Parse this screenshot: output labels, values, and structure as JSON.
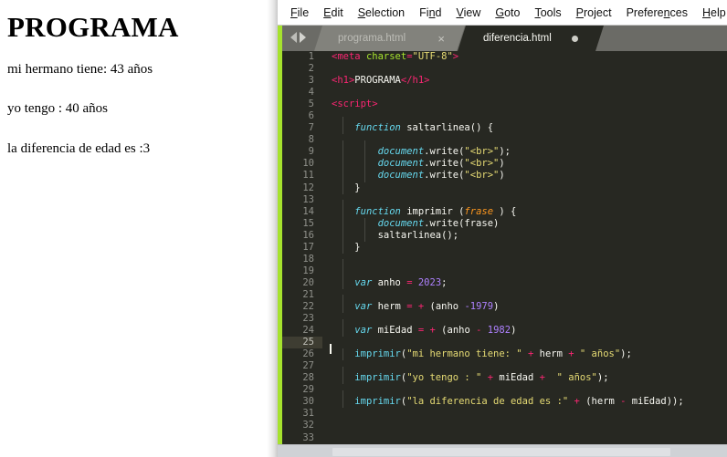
{
  "browser_output": {
    "heading": "PROGRAMA",
    "lines": [
      "mi hermano tiene: 43 años",
      "yo tengo : 40 años",
      "la diferencia de edad es :3"
    ]
  },
  "editor": {
    "app": "Sublime Text",
    "menu": [
      {
        "label": "File",
        "accel": "F"
      },
      {
        "label": "Edit",
        "accel": "E"
      },
      {
        "label": "Selection",
        "accel": "S"
      },
      {
        "label": "Find",
        "accel": "n"
      },
      {
        "label": "View",
        "accel": "V"
      },
      {
        "label": "Goto",
        "accel": "G"
      },
      {
        "label": "Tools",
        "accel": "T"
      },
      {
        "label": "Project",
        "accel": "P"
      },
      {
        "label": "Preferences",
        "accel": "n"
      },
      {
        "label": "Help",
        "accel": "H"
      }
    ],
    "tabs": [
      {
        "label": "programa.html",
        "active": false,
        "close_glyph": "×",
        "modified": false
      },
      {
        "label": "diferencia.html",
        "active": true,
        "close_glyph": "",
        "modified": true
      }
    ],
    "nav": {
      "back": "back-arrow",
      "forward": "forward-arrow"
    },
    "active_line": 25,
    "cursor_line": 25,
    "total_visible_lines": 33,
    "colors": {
      "background": "#272822",
      "gutter_text": "#8f908a",
      "active_line_bg": "#3e3d32",
      "accent_strip": "#a6e22e",
      "tag": "#f92672",
      "string": "#e6db74",
      "keyword": "#66d9ef",
      "number": "#ae81ff",
      "parameter": "#fd971f",
      "function": "#a6e22e",
      "plain": "#f8f8f2",
      "tabbar": "#6b6b66",
      "tab_inactive": "#82827c"
    },
    "code_lines": [
      {
        "n": 1,
        "text": "<meta charset=\"UTF-8\">"
      },
      {
        "n": 2,
        "text": ""
      },
      {
        "n": 3,
        "text": "<h1>PROGRAMA</h1>"
      },
      {
        "n": 4,
        "text": ""
      },
      {
        "n": 5,
        "text": "<script>"
      },
      {
        "n": 6,
        "text": ""
      },
      {
        "n": 7,
        "text": "    function saltarlinea() {"
      },
      {
        "n": 8,
        "text": ""
      },
      {
        "n": 9,
        "text": "        document.write(\"<br>\");"
      },
      {
        "n": 10,
        "text": "        document.write(\"<br>\")"
      },
      {
        "n": 11,
        "text": "        document.write(\"<br>\")"
      },
      {
        "n": 12,
        "text": "    }"
      },
      {
        "n": 13,
        "text": ""
      },
      {
        "n": 14,
        "text": "    function imprimir (frase ) {"
      },
      {
        "n": 15,
        "text": "        document.write(frase)"
      },
      {
        "n": 16,
        "text": "        saltarlinea();"
      },
      {
        "n": 17,
        "text": "    }"
      },
      {
        "n": 18,
        "text": ""
      },
      {
        "n": 19,
        "text": ""
      },
      {
        "n": 20,
        "text": "    var anho = 2023;"
      },
      {
        "n": 21,
        "text": ""
      },
      {
        "n": 22,
        "text": "    var herm = + (anho -1979)"
      },
      {
        "n": 23,
        "text": ""
      },
      {
        "n": 24,
        "text": "    var miEdad = + (anho - 1982)"
      },
      {
        "n": 25,
        "text": ""
      },
      {
        "n": 26,
        "text": "    imprimir(\"mi hermano tiene: \" + herm + \" años\");"
      },
      {
        "n": 27,
        "text": ""
      },
      {
        "n": 28,
        "text": "    imprimir(\"yo tengo : \" + miEdad +  \" años\");"
      },
      {
        "n": 29,
        "text": ""
      },
      {
        "n": 30,
        "text": "    imprimir(\"la diferencia de edad es :\" + (herm - miEdad));"
      },
      {
        "n": 31,
        "text": ""
      },
      {
        "n": 32,
        "text": ""
      },
      {
        "n": 33,
        "text": ""
      }
    ]
  }
}
